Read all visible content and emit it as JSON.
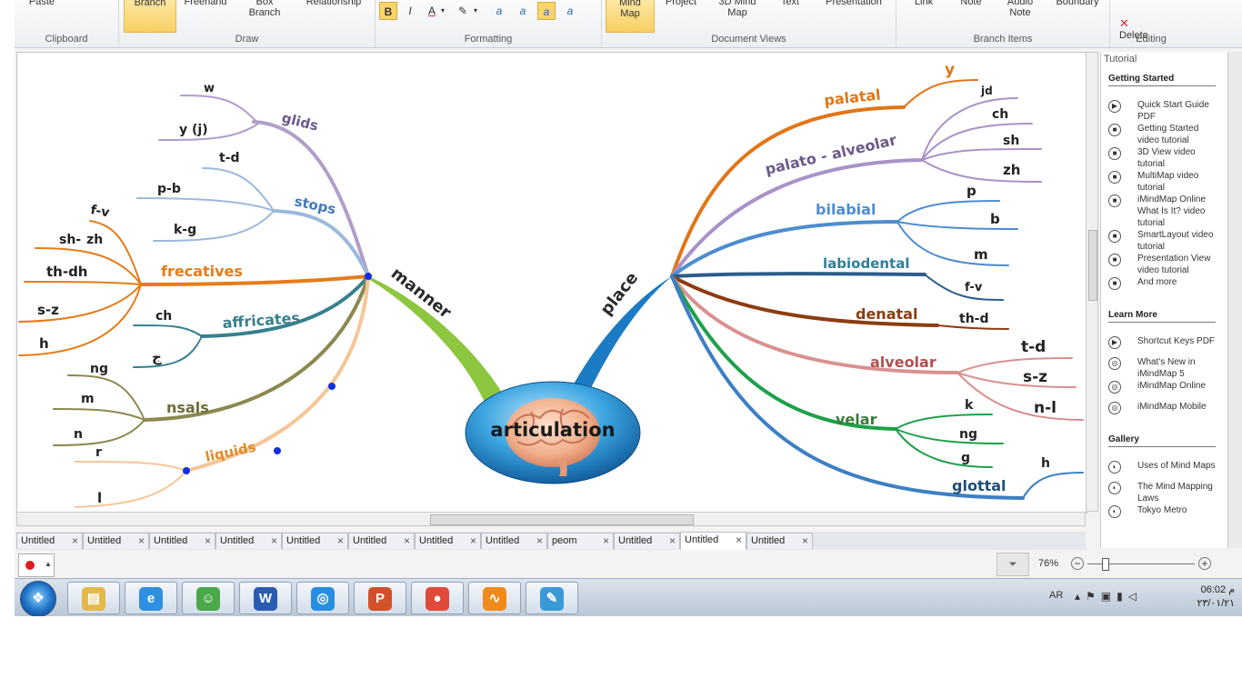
{
  "ribbon": {
    "groups": [
      {
        "label": "Clipboard",
        "buttons": [
          "Paste"
        ]
      },
      {
        "label": "Draw",
        "buttons": [
          "Branch",
          "Freehand",
          "Box\nBranch",
          "Relationship"
        ]
      },
      {
        "label": "Formatting",
        "buttons": [
          "B",
          "I",
          "A",
          "▾",
          "✎",
          "▾",
          "a",
          "a",
          "a",
          "a"
        ]
      },
      {
        "label": "Document Views",
        "buttons": [
          "Mind\nMap",
          "Project",
          "3D Mind\nMap",
          "Text",
          "Presentation"
        ]
      },
      {
        "label": "Branch Items",
        "buttons": [
          "Link",
          "Note",
          "Audio\nNote",
          "Boundary"
        ]
      },
      {
        "label": "Editing",
        "buttons": [
          "✕",
          "Delete"
        ]
      }
    ]
  },
  "mindmap": {
    "central": "articulation",
    "main": [
      "manner",
      "place"
    ],
    "left": {
      "glids": "glids",
      "w": "w",
      "yj": "y (j)",
      "stops": "stops",
      "td": "t-d",
      "pb": "p-b",
      "kg": "k-g",
      "frecatives": "frecatives",
      "fv": "f-v",
      "shzh1": "sh-",
      "shzh2": "zh",
      "thdh": "th-dh",
      "sz": "s-z",
      "h": "h",
      "affricates": "affricates",
      "ch": "ch",
      "dj": "ج",
      "nsals": "nsals",
      "ng": "ng",
      "m": "m",
      "n": "n",
      "liquids": "liquids",
      "r": "r",
      "l": "l"
    },
    "right": {
      "palatal": "palatal",
      "y": "y",
      "palatoalveolar": "palato - alveolar",
      "jd": "jd",
      "ch": "ch",
      "sh": "sh",
      "zh": "zh",
      "bilabial": "bilabial",
      "p": "p",
      "b": "b",
      "m": "m",
      "labiodental": "labiodental",
      "fv": "f-v",
      "denatal": "denatal",
      "thd": "th-d",
      "alveolar": "alveolar",
      "td": "t-d",
      "sz": "s-z",
      "nl": "n-l",
      "velar": "velar",
      "k": "k",
      "ng": "ng",
      "g": "g",
      "glottal": "glottal",
      "h": "h"
    }
  },
  "tutorial": {
    "title": "Tutorial",
    "sections": [
      {
        "heading": "Getting Started",
        "items": [
          {
            "icon": "▶",
            "text": "Quick Start Guide PDF"
          },
          {
            "icon": "■",
            "text": "Getting Started video tutorial"
          },
          {
            "icon": "■",
            "text": "3D View video tutorial"
          },
          {
            "icon": "■",
            "text": "MultiMap video tutorial"
          },
          {
            "icon": "■",
            "text": "iMindMap Online What Is It? video tutorial"
          },
          {
            "icon": "■",
            "text": "SmartLayout video tutorial"
          },
          {
            "icon": "■",
            "text": "Presentation View video tutorial"
          },
          {
            "icon": "■",
            "text": "And more"
          }
        ]
      },
      {
        "heading": "Learn More",
        "items": [
          {
            "icon": "▶",
            "text": "Shortcut Keys PDF"
          },
          {
            "icon": "◎",
            "text": "What's New in iMindMap 5"
          },
          {
            "icon": "◎",
            "text": "iMindMap Online"
          },
          {
            "icon": "◎",
            "text": "iMindMap Mobile"
          }
        ]
      },
      {
        "heading": "Gallery",
        "items": [
          {
            "icon": "◐",
            "text": "Uses of Mind Maps"
          },
          {
            "icon": "◐",
            "text": "The Mind Mapping Laws"
          },
          {
            "icon": "◐",
            "text": "Tokyo Metro"
          }
        ]
      }
    ]
  },
  "tabs": [
    "Untitled",
    "Untitled",
    "Untitled",
    "Untitled",
    "Untitled",
    "Untitled",
    "Untitled",
    "Untitled",
    "peom",
    "Untitled",
    "Untitled",
    "Untitled"
  ],
  "active_tab": 10,
  "status": {
    "zoom": "76%"
  },
  "taskbar": {
    "lang": "AR",
    "time": "06:02 م",
    "date": "٢٣/٠١/٢١",
    "apps": [
      {
        "name": "explorer",
        "glyph": "▤",
        "color": "#e5b84a"
      },
      {
        "name": "ie",
        "glyph": "e",
        "color": "#2f8fe0"
      },
      {
        "name": "messenger",
        "glyph": "☺",
        "color": "#4aa84a"
      },
      {
        "name": "word",
        "glyph": "W",
        "color": "#2a5db0"
      },
      {
        "name": "safari",
        "glyph": "◎",
        "color": "#2a8ee0"
      },
      {
        "name": "powerpoint",
        "glyph": "P",
        "color": "#d2502a"
      },
      {
        "name": "chrome",
        "glyph": "●",
        "color": "#e04a3a"
      },
      {
        "name": "imindmap",
        "glyph": "∿",
        "color": "#f08a1a"
      },
      {
        "name": "paint",
        "glyph": "✎",
        "color": "#3a9ad8"
      }
    ]
  }
}
